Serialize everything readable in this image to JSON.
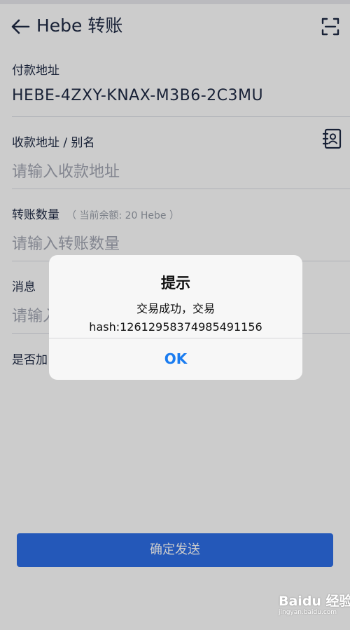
{
  "header": {
    "title": "Hebe 转账",
    "back_icon": "arrow-left-icon",
    "scan_icon": "scan-icon"
  },
  "payer": {
    "label": "付款地址",
    "value": "HEBE-4ZXY-KNAX-M3B6-2C3MU"
  },
  "payee": {
    "label": "收款地址 / 别名",
    "placeholder": "请输入收款地址",
    "icon": "contact-book-icon"
  },
  "amount": {
    "label": "转账数量",
    "hint": "（ 当前余额:  20 Hebe ）",
    "placeholder": "请输入转账数量"
  },
  "message": {
    "label": "消息",
    "placeholder_visible": "请输入"
  },
  "encrypt": {
    "label_visible": "是否加"
  },
  "send_button": "确定发送",
  "dialog": {
    "title": "提示",
    "message_line1": "交易成功，交易",
    "message_line2": "hash:12612958374985491156",
    "ok": "OK"
  },
  "watermark": {
    "brand": "Baidu 经验",
    "url": "jingyan.baidu.com"
  },
  "colors": {
    "primary": "#2d6fe8",
    "link": "#1a7cf0",
    "text": "#1f2a44",
    "placeholder": "#a3a7b3"
  }
}
